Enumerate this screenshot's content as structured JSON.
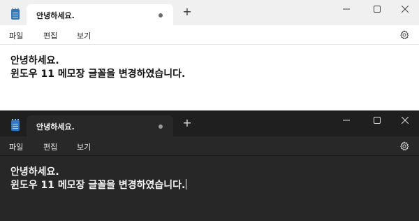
{
  "windows": [
    {
      "theme": "light",
      "tab_title": "안녕하세요.",
      "new_tab_glyph": "+",
      "unsaved_indicator": "dot",
      "menu": [
        "파일",
        "편집",
        "보기"
      ],
      "settings_icon": "gear-icon",
      "window_controls": [
        "minimize-icon",
        "maximize-icon",
        "close-icon"
      ],
      "content_lines": [
        "안녕하세요.",
        "윈도우 11 메모장 글꼴을 변경하였습니다."
      ],
      "colors": {
        "background": "#ffffff",
        "titlebar": "#f0f0f0",
        "text": "#111111"
      }
    },
    {
      "theme": "dark",
      "tab_title": "안녕하세요.",
      "new_tab_glyph": "+",
      "unsaved_indicator": "dot",
      "menu": [
        "파일",
        "편집",
        "보기"
      ],
      "settings_icon": "gear-icon",
      "window_controls": [
        "minimize-icon",
        "maximize-icon",
        "close-icon"
      ],
      "content_lines": [
        "안녕하세요.",
        "윈도우 11 메모장 글꼴을 변경하였습니다."
      ],
      "colors": {
        "background": "#272727",
        "titlebar": "#1f1f1f",
        "text": "#f2f2f2"
      }
    }
  ]
}
